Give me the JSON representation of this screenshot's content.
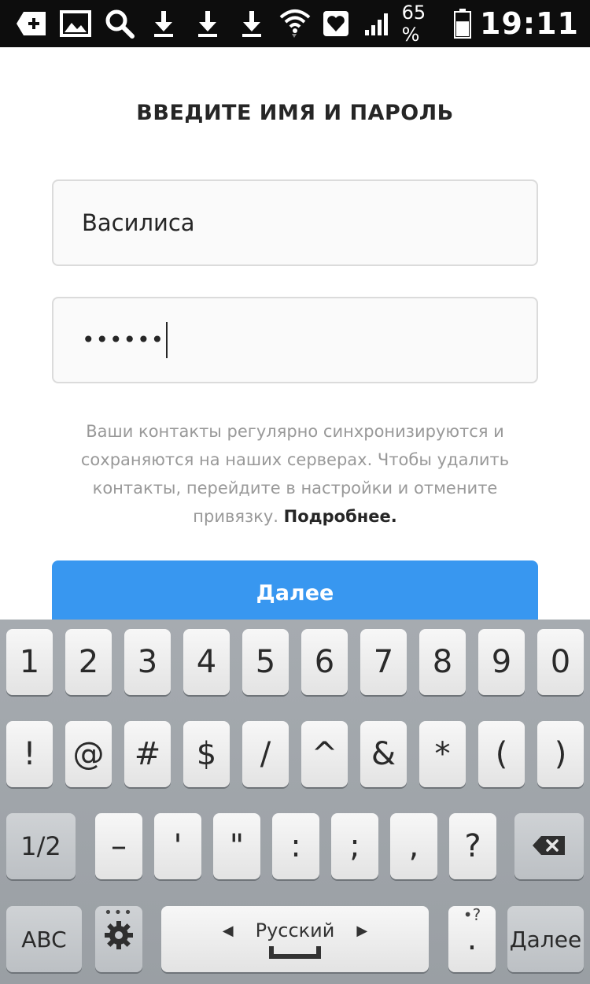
{
  "status_bar": {
    "left_icons": [
      "add-message-icon",
      "image-icon",
      "search-icon",
      "download-icon",
      "download-icon",
      "download-icon"
    ],
    "right_icons": [
      "wifi-icon",
      "heart-icon",
      "signal-icon"
    ],
    "battery_percent": "65 %",
    "battery_level": 0.65,
    "time": "19:11"
  },
  "form": {
    "title": "ВВЕДИТЕ ИМЯ И ПАРОЛЬ",
    "username_value": "Василиса",
    "password_masked": "••••••",
    "info_text": "Ваши контакты регулярно синхронизируются и сохраняются на наших серверах. Чтобы удалить контакты, перейдите в настройки и отмените привязку.",
    "info_link": "Подробнее.",
    "next_button": "Далее"
  },
  "keyboard": {
    "row1": [
      "1",
      "2",
      "3",
      "4",
      "5",
      "6",
      "7",
      "8",
      "9",
      "0"
    ],
    "row2": [
      "!",
      "@",
      "#",
      "$",
      "/",
      "^",
      "&",
      "*",
      "(",
      ")"
    ],
    "row3": [
      "1/2",
      "–",
      "'",
      "\"",
      ":",
      ";",
      ",",
      "?"
    ],
    "abc_label": "ABC",
    "gear_hint": "•••",
    "language_label": "Русский",
    "period_label": ".",
    "period_hint": "•?",
    "enter_label": "Далее",
    "accent_color": "#3897f0"
  }
}
